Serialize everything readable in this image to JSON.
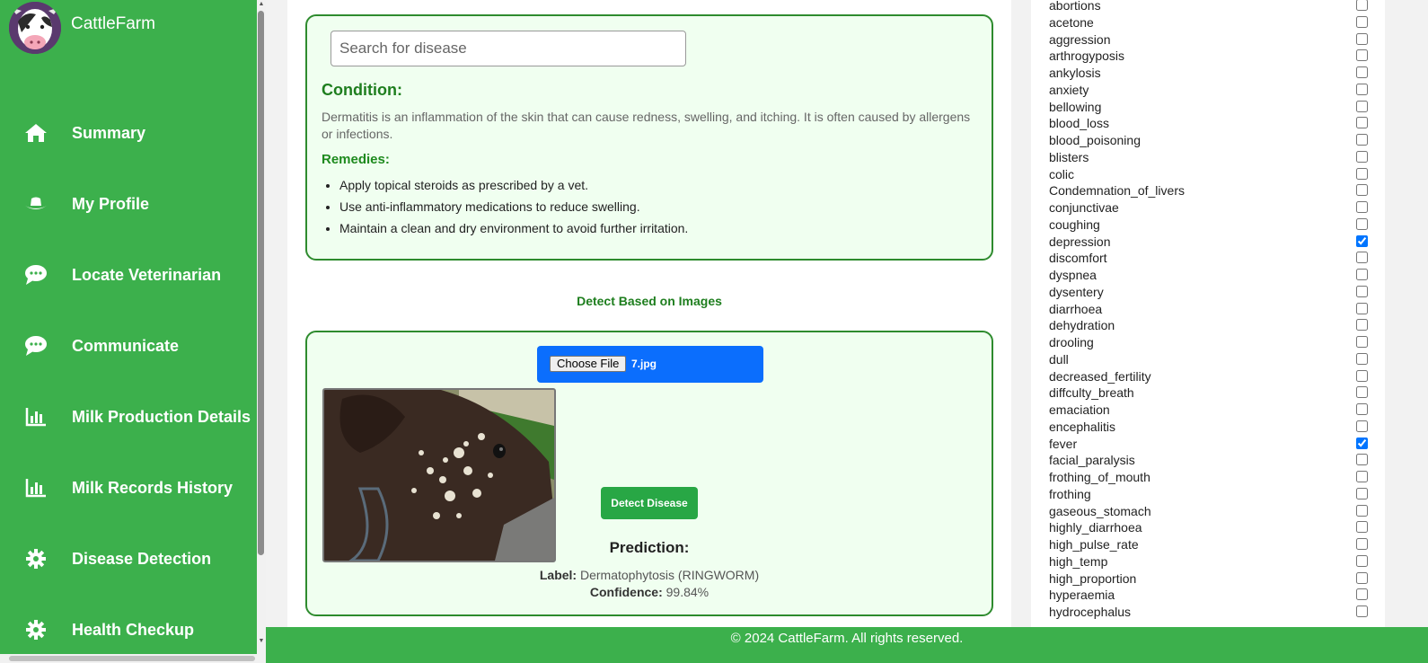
{
  "app": {
    "name": "CattleFarm"
  },
  "nav": [
    {
      "label": "Summary",
      "icon": "home-icon"
    },
    {
      "label": "My Profile",
      "icon": "hat-icon"
    },
    {
      "label": "Locate Veterinarian",
      "icon": "chat-icon"
    },
    {
      "label": "Communicate",
      "icon": "chat-icon"
    },
    {
      "label": "Milk Production Details",
      "icon": "bar-chart-icon"
    },
    {
      "label": "Milk Records History",
      "icon": "bar-chart-icon"
    },
    {
      "label": "Disease Detection",
      "icon": "gear-icon"
    },
    {
      "label": "Health Checkup",
      "icon": "gear-icon"
    }
  ],
  "search": {
    "placeholder": "Search for disease"
  },
  "condition": {
    "title": "Condition:",
    "text": "Dermatitis is an inflammation of the skin that can cause redness, swelling, and itching. It is often caused by allergens or infections."
  },
  "remedies": {
    "title": "Remedies:",
    "items": [
      "Apply topical steroids as prescribed by a vet.",
      "Use anti-inflammatory medications to reduce swelling.",
      "Maintain a clean and dry environment to avoid further irritation."
    ]
  },
  "image_detection": {
    "heading": "Detect Based on Images",
    "choose_file_label": "Choose File",
    "file_name": "7.jpg",
    "detect_button": "Detect Disease",
    "prediction_title": "Prediction:",
    "label_key": "Label:",
    "label_value": "Dermatophytosis (RINGWORM)",
    "confidence_key": "Confidence:",
    "confidence_value": "99.84%"
  },
  "symptoms": [
    {
      "name": "abortions",
      "checked": false
    },
    {
      "name": "acetone",
      "checked": false
    },
    {
      "name": "aggression",
      "checked": false
    },
    {
      "name": "arthrogyposis",
      "checked": false
    },
    {
      "name": "ankylosis",
      "checked": false
    },
    {
      "name": "anxiety",
      "checked": false
    },
    {
      "name": "bellowing",
      "checked": false
    },
    {
      "name": "blood_loss",
      "checked": false
    },
    {
      "name": "blood_poisoning",
      "checked": false
    },
    {
      "name": "blisters",
      "checked": false
    },
    {
      "name": "colic",
      "checked": false
    },
    {
      "name": "Condemnation_of_livers",
      "checked": false
    },
    {
      "name": "conjunctivae",
      "checked": false
    },
    {
      "name": "coughing",
      "checked": false
    },
    {
      "name": "depression",
      "checked": true
    },
    {
      "name": "discomfort",
      "checked": false
    },
    {
      "name": "dyspnea",
      "checked": false
    },
    {
      "name": "dysentery",
      "checked": false
    },
    {
      "name": "diarrhoea",
      "checked": false
    },
    {
      "name": "dehydration",
      "checked": false
    },
    {
      "name": "drooling",
      "checked": false
    },
    {
      "name": "dull",
      "checked": false
    },
    {
      "name": "decreased_fertility",
      "checked": false
    },
    {
      "name": "diffculty_breath",
      "checked": false
    },
    {
      "name": "emaciation",
      "checked": false
    },
    {
      "name": "encephalitis",
      "checked": false
    },
    {
      "name": "fever",
      "checked": true
    },
    {
      "name": "facial_paralysis",
      "checked": false
    },
    {
      "name": "frothing_of_mouth",
      "checked": false
    },
    {
      "name": "frothing",
      "checked": false
    },
    {
      "name": "gaseous_stomach",
      "checked": false
    },
    {
      "name": "highly_diarrhoea",
      "checked": false
    },
    {
      "name": "high_pulse_rate",
      "checked": false
    },
    {
      "name": "high_temp",
      "checked": false
    },
    {
      "name": "high_proportion",
      "checked": false
    },
    {
      "name": "hyperaemia",
      "checked": false
    },
    {
      "name": "hydrocephalus",
      "checked": false
    }
  ],
  "footer": {
    "text": "© 2024 CattleFarm. All rights reserved."
  }
}
